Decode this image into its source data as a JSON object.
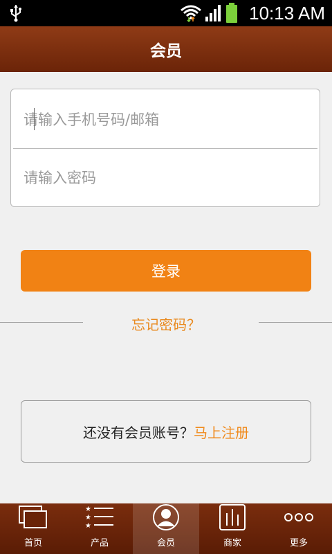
{
  "status_bar": {
    "time": "10:13 AM",
    "icons": [
      "usb-icon",
      "wifi-icon",
      "signal-icon",
      "battery-icon"
    ]
  },
  "header": {
    "title": "会员"
  },
  "login": {
    "phone_placeholder": "请输入手机号码/邮箱",
    "password_placeholder": "请输入密码",
    "login_label": "登录",
    "forgot_label": "忘记密码？"
  },
  "register": {
    "prompt": "还没有会员账号？",
    "link": "马上注册"
  },
  "tabs": [
    {
      "label": "首页",
      "icon": "home-icon"
    },
    {
      "label": "产品",
      "icon": "product-list-icon"
    },
    {
      "label": "会员",
      "icon": "member-icon",
      "active": true
    },
    {
      "label": "商家",
      "icon": "merchant-icon"
    },
    {
      "label": "更多",
      "icon": "more-icon"
    }
  ],
  "colors": {
    "header": "#7a2d0e",
    "accent": "#f18214",
    "background": "#f0f0f0"
  }
}
